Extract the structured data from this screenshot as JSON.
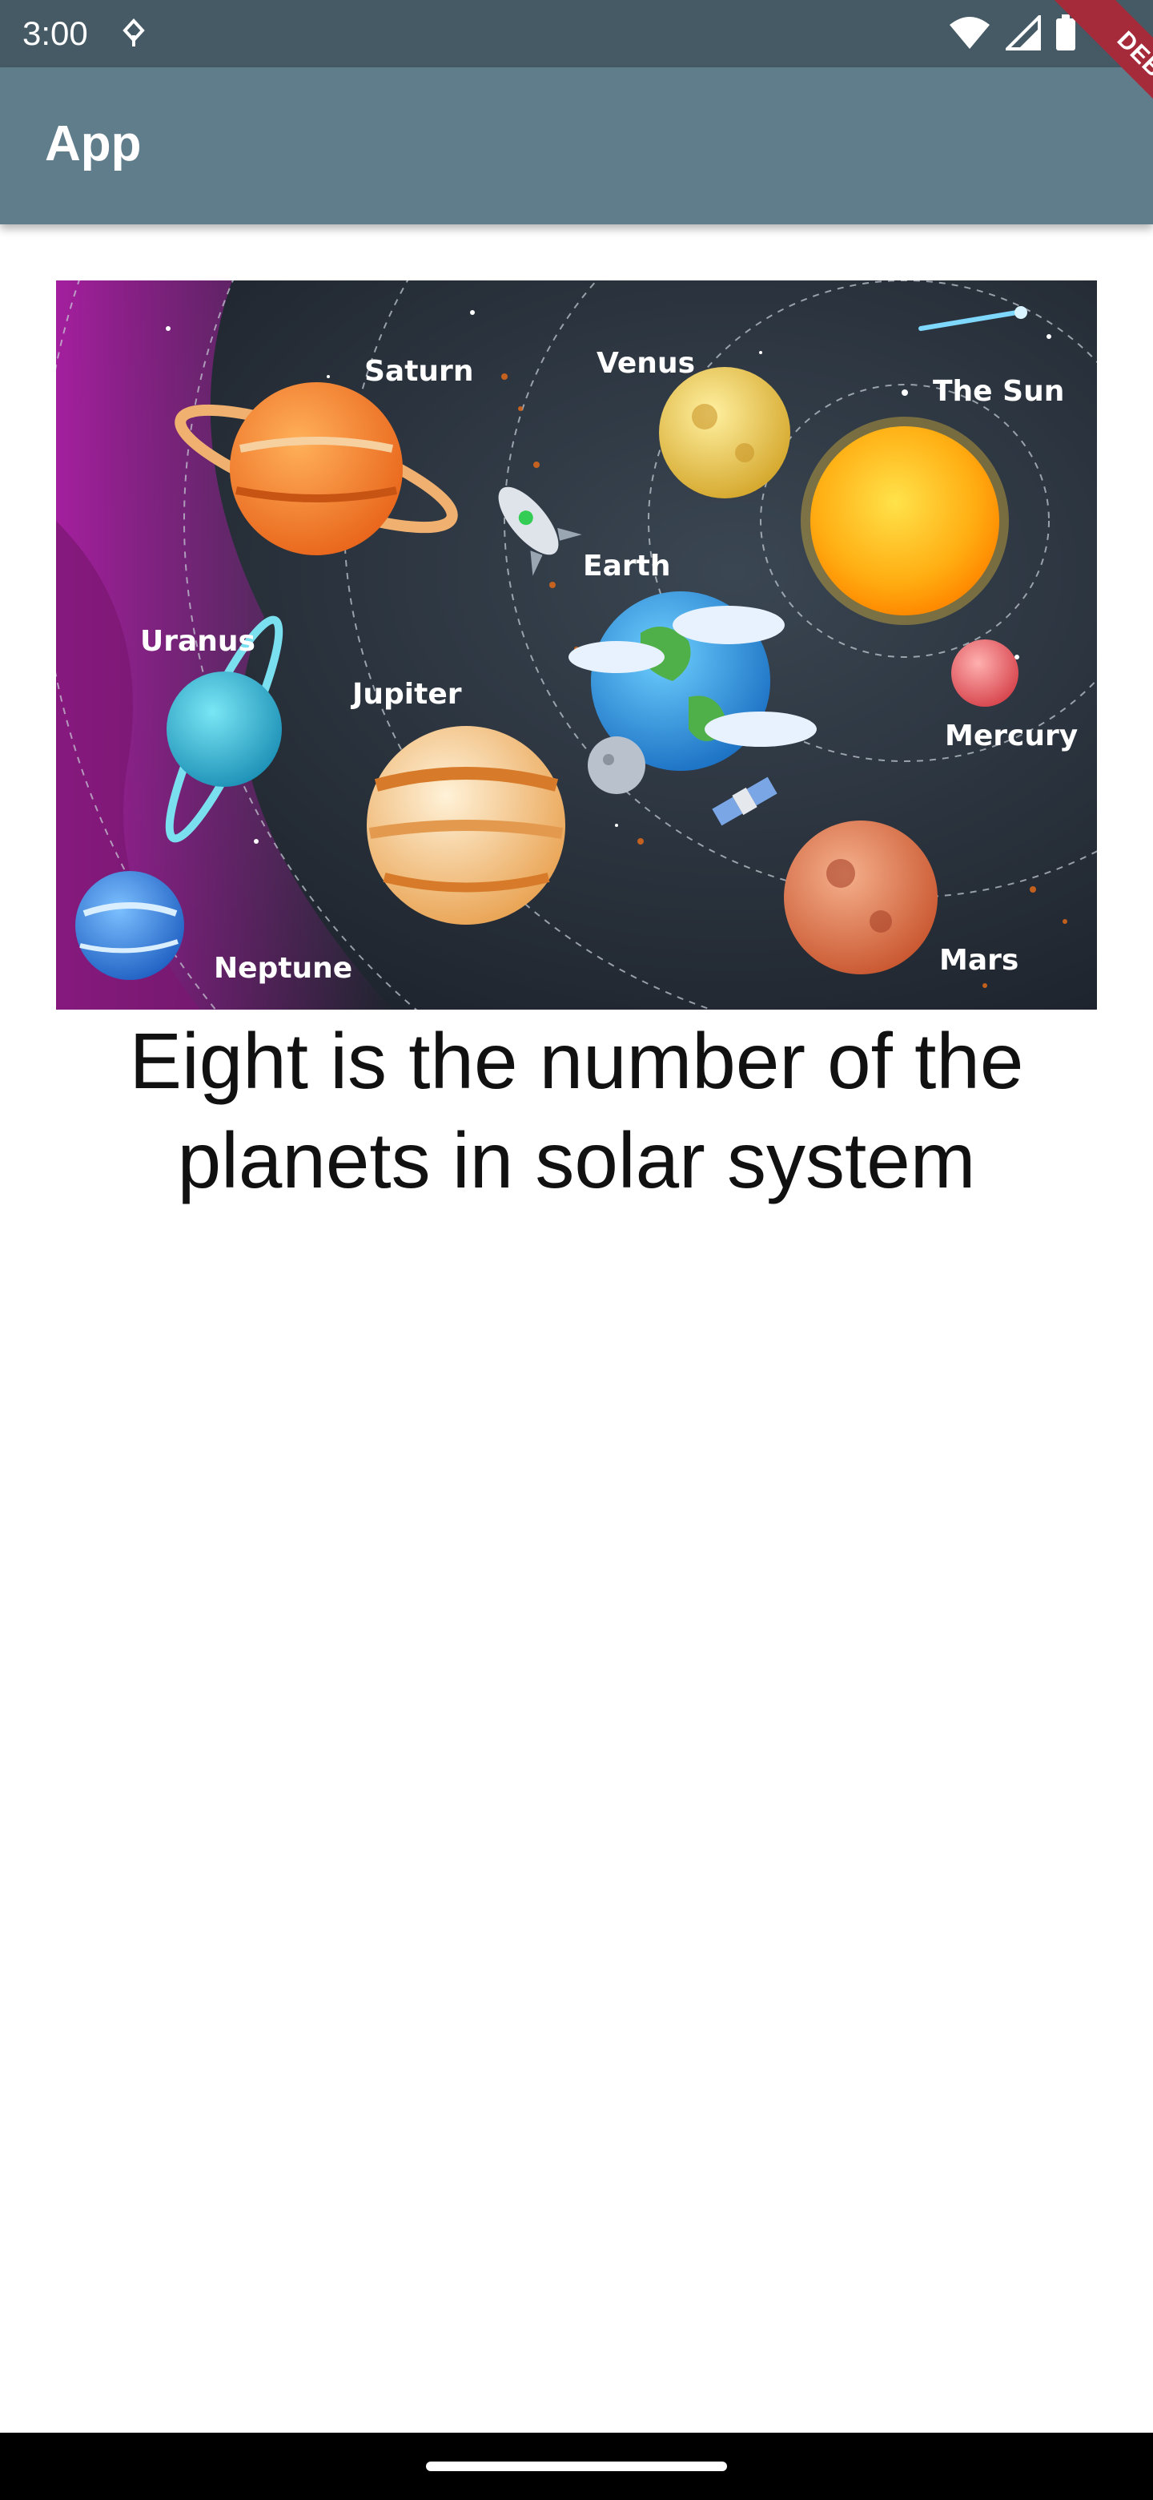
{
  "status_bar": {
    "time": "3:00",
    "icons": [
      "notification-icon",
      "wifi-icon",
      "signal-icon",
      "battery-icon"
    ]
  },
  "app_bar": {
    "title": "App"
  },
  "debug_banner": {
    "label": "DEBUG"
  },
  "hero_image": {
    "planet_labels": {
      "saturn": "Saturn",
      "venus": "Venus",
      "sun": "The Sun",
      "earth": "Earth",
      "uranus": "Uranus",
      "jupiter": "Jupiter",
      "mercury": "Mercury",
      "neptune": "Neptune",
      "mars": "Mars"
    }
  },
  "caption": {
    "text": "Eight is the number of the planets in solar system"
  },
  "colors": {
    "status_bar": "#455a64",
    "app_bar": "#607d8b",
    "debug_ribbon": "#a52a3a"
  }
}
